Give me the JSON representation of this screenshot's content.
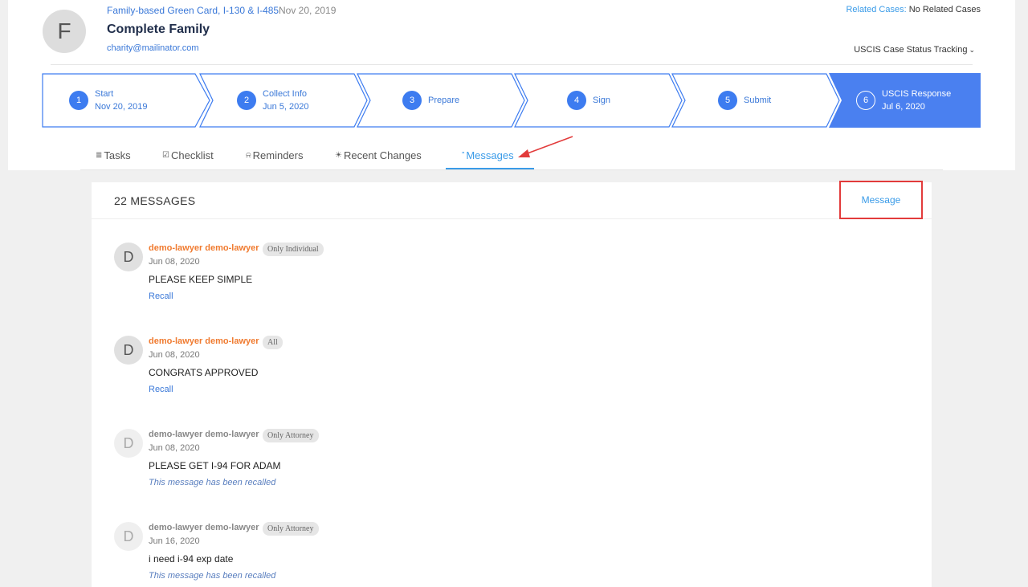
{
  "header": {
    "avatar_letter": "F",
    "case_type": "Family-based Green Card, I-130 & I-485",
    "case_date": "Nov 20, 2019",
    "family_name": "Complete Family",
    "email": "charity@mailinator.com",
    "related_label": "Related Cases:",
    "related_value": "No Related Cases",
    "uscis_tracking": "USCIS Case Status Tracking",
    "uscis_chevron": "⌄"
  },
  "steps": [
    {
      "num": "1",
      "title": "Start",
      "date": "Nov 20, 2019"
    },
    {
      "num": "2",
      "title": "Collect Info",
      "date": "Jun 5, 2020"
    },
    {
      "num": "3",
      "title": "Prepare",
      "date": ""
    },
    {
      "num": "4",
      "title": "Sign",
      "date": ""
    },
    {
      "num": "5",
      "title": "Submit",
      "date": ""
    },
    {
      "num": "6",
      "title": "USCIS Response",
      "date": "Jul 6, 2020"
    }
  ],
  "colors": {
    "accent": "#3d7cf0",
    "active_step": "#4a80f0",
    "author": "#f07b30",
    "annotation": "#e23b3b"
  },
  "tabs": [
    {
      "icon": "≣",
      "label": "Tasks"
    },
    {
      "icon": "☑",
      "label": "Checklist"
    },
    {
      "icon": "⍾",
      "label": "Reminders"
    },
    {
      "icon": "☀",
      "label": "Recent Changes"
    },
    {
      "icon": "”",
      "label": "Messages"
    }
  ],
  "messages_panel": {
    "count_label": "22 MESSAGES",
    "message_button": "Message"
  },
  "messages": [
    {
      "avatar": "D",
      "author": "demo-lawyer demo-lawyer",
      "badge": "Only Individual",
      "date": "Jun 08, 2020",
      "text": "PLEASE KEEP SIMPLE",
      "action": "Recall"
    },
    {
      "avatar": "D",
      "author": "demo-lawyer demo-lawyer",
      "badge": "All",
      "date": "Jun 08, 2020",
      "text": "CONGRATS APPROVED",
      "action": "Recall"
    },
    {
      "avatar": "D",
      "author": "demo-lawyer demo-lawyer",
      "badge": "Only Attorney",
      "date": "Jun 08, 2020",
      "text": "PLEASE GET I-94 FOR ADAM",
      "note": "This message has been recalled"
    },
    {
      "avatar": "D",
      "author": "demo-lawyer demo-lawyer",
      "badge": "Only Attorney",
      "date": "Jun 16, 2020",
      "text": "i need i-94 exp date",
      "note": "This message has been recalled"
    }
  ]
}
